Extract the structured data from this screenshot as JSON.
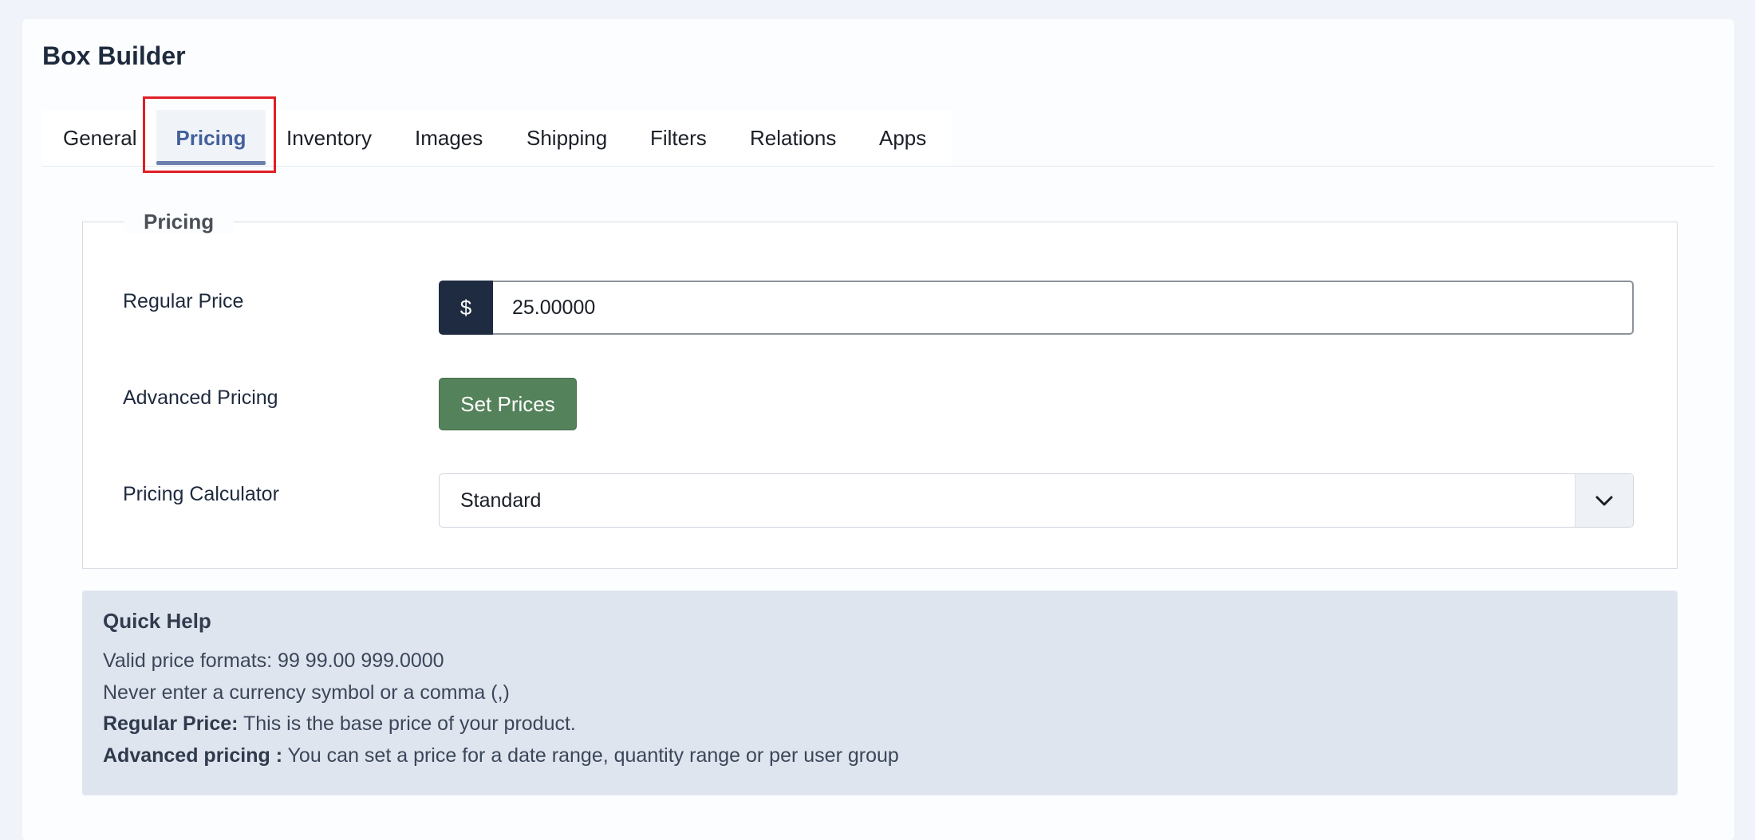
{
  "page": {
    "title": "Box Builder"
  },
  "tabs": [
    {
      "label": "General",
      "active": false
    },
    {
      "label": "Pricing",
      "active": true
    },
    {
      "label": "Inventory",
      "active": false
    },
    {
      "label": "Images",
      "active": false
    },
    {
      "label": "Shipping",
      "active": false
    },
    {
      "label": "Filters",
      "active": false
    },
    {
      "label": "Relations",
      "active": false
    },
    {
      "label": "Apps",
      "active": false
    }
  ],
  "pricing": {
    "legend": "Pricing",
    "regular_price": {
      "label": "Regular Price",
      "currency_symbol": "$",
      "value": "25.00000"
    },
    "advanced_pricing": {
      "label": "Advanced Pricing",
      "button_label": "Set Prices"
    },
    "pricing_calculator": {
      "label": "Pricing Calculator",
      "selected": "Standard"
    }
  },
  "quick_help": {
    "title": "Quick Help",
    "line1": "Valid price formats: 99 99.00 999.0000",
    "line2": "Never enter a currency symbol or a comma (,)",
    "line3_label": "Regular Price:",
    "line3_text": " This is the base price of your product.",
    "line4_label": "Advanced pricing :",
    "line4_text": " You can set a price for a date range, quantity range or per user group"
  },
  "colors": {
    "accent": "#44609c",
    "tab_underline": "#6a80ad",
    "highlight": "#e01e26",
    "button_green": "#54825a",
    "prefix_dark": "#1e2b40",
    "help_background": "#dfe5ef"
  }
}
